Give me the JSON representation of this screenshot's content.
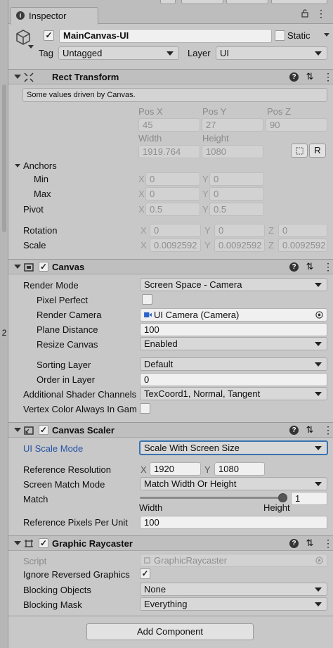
{
  "inspector": {
    "tab_label": "Inspector",
    "object_name": "MainCanvas-UI",
    "active_checked": true,
    "static_label": "Static",
    "tag_label": "Tag",
    "tag_value": "Untagged",
    "layer_label": "Layer",
    "layer_value": "UI",
    "left_strip_number": "2"
  },
  "rect_transform": {
    "title": "Rect Transform",
    "note": "Some values driven by Canvas.",
    "pos_x_label": "Pos X",
    "pos_y_label": "Pos Y",
    "pos_z_label": "Pos Z",
    "pos_x": "45",
    "pos_y": "27",
    "pos_z": "90",
    "width_label": "Width",
    "height_label": "Height",
    "width": "1919.764",
    "height": "1080",
    "raw_button": "R",
    "anchors_label": "Anchors",
    "min_label": "Min",
    "max_label": "Max",
    "x_axis": "X",
    "y_axis": "Y",
    "z_axis": "Z",
    "anchor_min_x": "0",
    "anchor_min_y": "0",
    "anchor_max_x": "0",
    "anchor_max_y": "0",
    "pivot_label": "Pivot",
    "pivot_x": "0.5",
    "pivot_y": "0.5",
    "rotation_label": "Rotation",
    "rot_x": "0",
    "rot_y": "0",
    "rot_z": "0",
    "scale_label": "Scale",
    "scale_x": "0.0092592",
    "scale_y": "0.0092592",
    "scale_z": "0.0092592"
  },
  "canvas": {
    "title": "Canvas",
    "render_mode_label": "Render Mode",
    "render_mode": "Screen Space - Camera",
    "pixel_perfect_label": "Pixel Perfect",
    "render_camera_label": "Render Camera",
    "render_camera": "UI Camera (Camera)",
    "plane_distance_label": "Plane Distance",
    "plane_distance": "100",
    "resize_canvas_label": "Resize Canvas",
    "resize_canvas": "Enabled",
    "sorting_layer_label": "Sorting Layer",
    "sorting_layer": "Default",
    "order_in_layer_label": "Order in Layer",
    "order_in_layer": "0",
    "shader_channels_label": "Additional Shader Channels",
    "shader_channels": "TexCoord1, Normal, Tangent",
    "vertex_color_label": "Vertex Color Always In Gam"
  },
  "canvas_scaler": {
    "title": "Canvas Scaler",
    "ui_scale_mode_label": "UI Scale Mode",
    "ui_scale_mode": "Scale With Screen Size",
    "ref_resolution_label": "Reference Resolution",
    "ref_x": "1920",
    "ref_y": "1080",
    "screen_match_label": "Screen Match Mode",
    "screen_match": "Match Width Or Height",
    "match_label": "Match",
    "match_value": "1",
    "match_fraction": 1,
    "width_caption": "Width",
    "height_caption": "Height",
    "ref_ppu_label": "Reference Pixels Per Unit",
    "ref_ppu": "100"
  },
  "graphic_raycaster": {
    "title": "Graphic Raycaster",
    "script_label": "Script",
    "script_value": "GraphicRaycaster",
    "ignore_reversed_label": "Ignore Reversed Graphics",
    "ignore_reversed_checked": true,
    "blocking_objects_label": "Blocking Objects",
    "blocking_objects": "None",
    "blocking_mask_label": "Blocking Mask",
    "blocking_mask": "Everything"
  },
  "add_component_label": "Add Component",
  "check_glyph": "✓",
  "colors": {
    "accent_blue": "#2453a6",
    "focus_border": "#3a72b0"
  }
}
